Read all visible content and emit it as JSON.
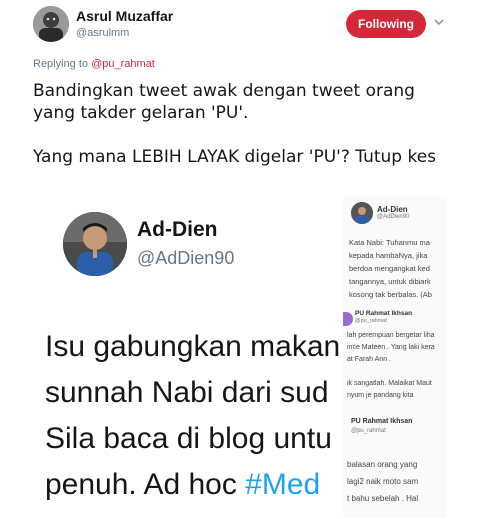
{
  "author": {
    "name": "Asrul Muzaffar",
    "handle": "@asrulmm"
  },
  "follow_button": "Following",
  "replying": {
    "prefix": "Replying to",
    "target": "@pu_rahmat"
  },
  "tweet": {
    "paragraph1": "Bandingkan tweet awak dengan tweet orang yang takder gelaran 'PU'.",
    "paragraph2": "Yang mana LEBIH LAYAK digelar 'PU'? Tutup kes"
  },
  "media": {
    "left": {
      "name": "Ad-Dien",
      "handle": "@AdDien90",
      "lines": [
        "Isu gabungkan makan",
        "sunnah Nabi dari sud",
        "Sila baca di blog untu"
      ],
      "last_line_text": "penuh. Ad hoc ",
      "last_line_hashtag": "#Med"
    },
    "right": {
      "name": "Ad-Dien",
      "handle": "@AdDien90",
      "lines": [
        "Kata Nabi: Tuhanmu ma",
        "kepada hambaNya, jika",
        "berdoa mengangkat ked",
        "tangannya, untuk dibiark",
        "kosong tak berbalas. (Ab"
      ],
      "name2": "PU Rahmat Ikhsan",
      "handle2": "@pu_rahmat",
      "lines2": [
        "lah perempuan bergetar liha",
        "ince Mateen . Yang laki kera",
        "at Farah Ann .",
        "",
        "ik sangatlah. Malaikat Maut",
        "nyum je pandang kita"
      ],
      "name3": "PU Rahmat Ikhsan",
      "handle3": "@pu_rahmat",
      "lines3": [
        "balasan orang yang",
        "lagi2 naik moto sam",
        "t bahu sebelah . Hal"
      ]
    }
  }
}
